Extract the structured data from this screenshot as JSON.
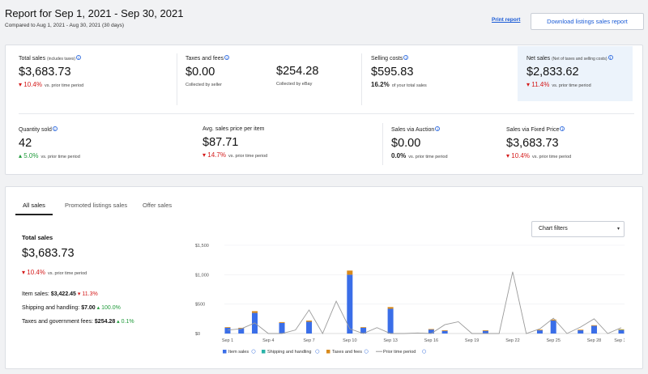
{
  "header": {
    "title": "Report for Sep 1, 2021 - Sep 30, 2021",
    "subtitle": "Compared to Aug 1, 2021 - Aug 30, 2021 (30 days)",
    "print_link": "Print report",
    "download_button": "Download listings sales report"
  },
  "summary": {
    "total_sales": {
      "label": "Total sales",
      "sub": "(includes taxes)",
      "value": "$3,683.73",
      "change": "10.4%",
      "cmp": "vs. prior time period"
    },
    "taxes_fees": {
      "label": "Taxes and fees",
      "seller_value": "$0.00",
      "seller_note": "Collected by seller",
      "ebay_value": "$254.28",
      "ebay_note": "Collected by eBay"
    },
    "selling_costs": {
      "label": "Selling costs",
      "value": "$595.83",
      "pct": "16.2%",
      "pct_note": "of your total sales"
    },
    "net_sales": {
      "label": "Net sales",
      "sub": "(Net of taxes and selling costs)",
      "value": "$2,833.62",
      "change": "11.4%",
      "cmp": "vs. prior time period"
    },
    "quantity_sold": {
      "label": "Quantity sold",
      "value": "42",
      "change": "5.0%",
      "cmp": "vs. prior time period"
    },
    "avg_price": {
      "label": "Avg. sales price per item",
      "value": "$87.71",
      "change": "14.7%",
      "cmp": "vs. prior time period"
    },
    "auction": {
      "label": "Sales via Auction",
      "value": "$0.00",
      "change": "0.0%",
      "cmp": "vs. prior time period"
    },
    "fixed_price": {
      "label": "Sales via Fixed Price",
      "value": "$3,683.73",
      "change": "10.4%",
      "cmp": "vs. prior time period"
    }
  },
  "detail": {
    "tabs": [
      "All sales",
      "Promoted listings sales",
      "Offer sales"
    ],
    "chart_filters": "Chart filters",
    "total_sales_label": "Total sales",
    "total_sales_value": "$3,683.73",
    "total_sales_change": "10.4%",
    "total_sales_cmp": "vs. prior time period",
    "item_sales_label": "Item sales:",
    "item_sales_value": "$3,422.45",
    "item_sales_change": "11.3%",
    "shipping_label": "Shipping and handling:",
    "shipping_value": "$7.00",
    "shipping_change": "100.0%",
    "taxes_label": "Taxes and government fees:",
    "taxes_value": "$254.28",
    "taxes_change": "0.1%"
  },
  "colors": {
    "item_sales": "#3a6ee8",
    "shipping": "#2bb3a8",
    "taxes": "#d88a1c",
    "prior": "#9a9a9a",
    "negative": "#d41a1a",
    "positive": "#1f9a3a"
  },
  "chart_data": {
    "type": "bar",
    "ylim": [
      0,
      1500
    ],
    "yticks": [
      0,
      500,
      1000,
      1500
    ],
    "ytick_labels": [
      "$0",
      "$500",
      "$1,000",
      "$1,500"
    ],
    "xtick_labels": [
      "Sep 1",
      "Sep 4",
      "Sep 7",
      "Sep 10",
      "Sep 13",
      "Sep 16",
      "Sep 19",
      "Sep 22",
      "Sep 25",
      "Sep 28",
      "Sep 30"
    ],
    "xtick_days": [
      1,
      4,
      7,
      10,
      13,
      16,
      19,
      22,
      25,
      28,
      30
    ],
    "days": [
      1,
      2,
      3,
      4,
      5,
      6,
      7,
      8,
      9,
      10,
      11,
      12,
      13,
      14,
      15,
      16,
      17,
      18,
      19,
      20,
      21,
      22,
      23,
      24,
      25,
      26,
      27,
      28,
      29,
      30
    ],
    "legend": [
      "Item sales",
      "Shipping and handling",
      "Taxes and fees",
      "Prior time period"
    ],
    "series": [
      {
        "name": "Item sales",
        "style": "bar",
        "values": [
          100,
          90,
          350,
          0,
          180,
          0,
          200,
          0,
          0,
          1000,
          100,
          0,
          420,
          0,
          0,
          70,
          50,
          0,
          0,
          50,
          0,
          0,
          0,
          60,
          220,
          0,
          60,
          130,
          0,
          60
        ]
      },
      {
        "name": "Shipping and handling",
        "style": "bar",
        "values": [
          0,
          0,
          0,
          0,
          0,
          0,
          0,
          0,
          0,
          0,
          0,
          0,
          0,
          0,
          0,
          0,
          0,
          0,
          0,
          0,
          0,
          0,
          0,
          0,
          0,
          0,
          0,
          0,
          0,
          7
        ]
      },
      {
        "name": "Taxes and fees",
        "style": "bar",
        "values": [
          8,
          7,
          30,
          0,
          14,
          0,
          20,
          0,
          0,
          70,
          8,
          0,
          30,
          0,
          0,
          6,
          4,
          0,
          0,
          4,
          0,
          0,
          0,
          5,
          18,
          0,
          5,
          11,
          0,
          5
        ]
      },
      {
        "name": "Prior time period",
        "style": "line",
        "values": [
          60,
          80,
          180,
          0,
          0,
          60,
          400,
          0,
          550,
          80,
          0,
          100,
          0,
          0,
          10,
          0,
          150,
          200,
          0,
          0,
          0,
          1050,
          0,
          80,
          260,
          0,
          110,
          250,
          0,
          100
        ]
      }
    ]
  }
}
